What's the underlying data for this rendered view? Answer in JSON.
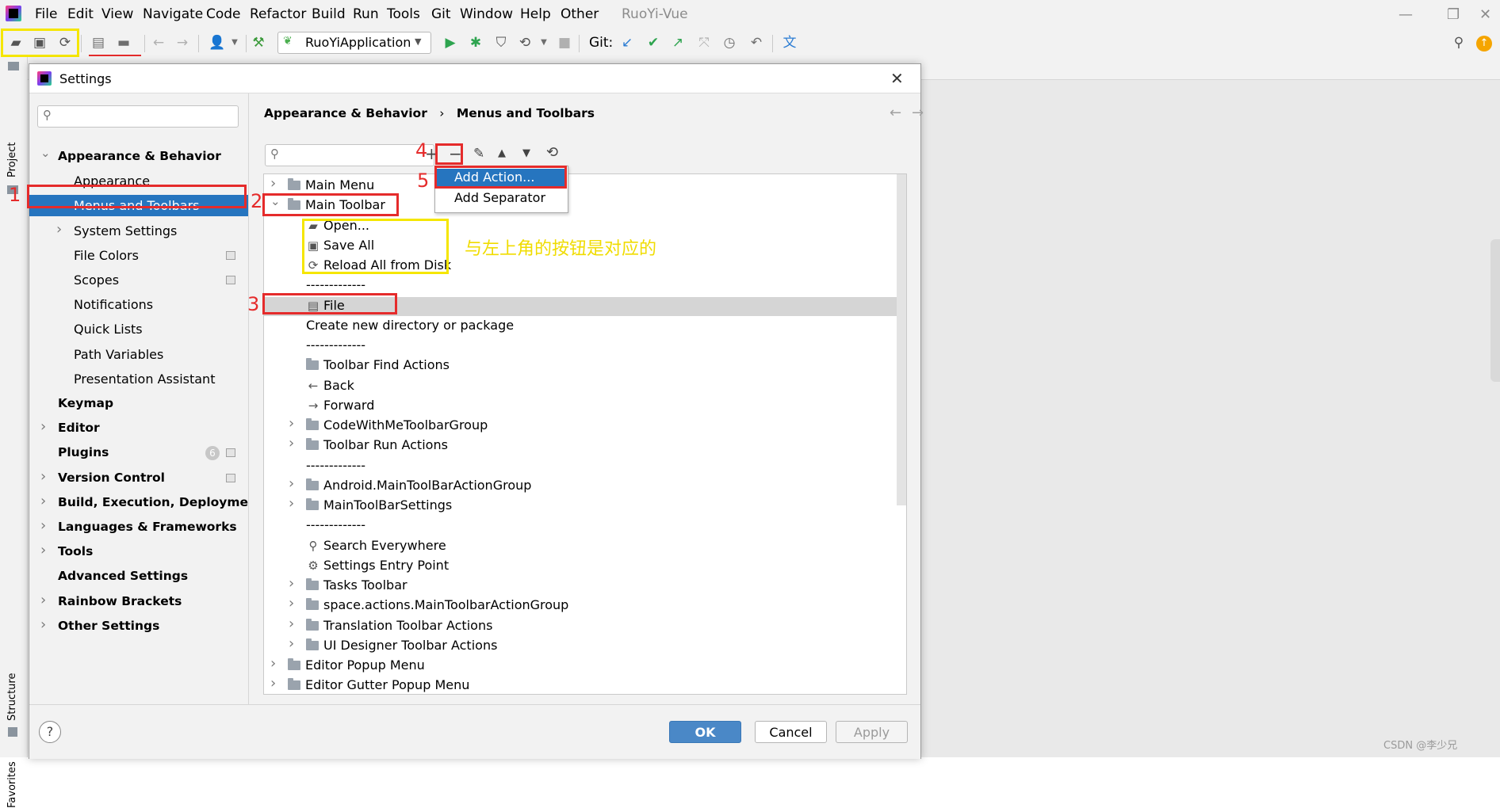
{
  "menubar": {
    "items": [
      "File",
      "Edit",
      "View",
      "Navigate",
      "Code",
      "Refactor",
      "Build",
      "Run",
      "Tools",
      "Git",
      "Window",
      "Help",
      "Other"
    ],
    "project_title": "RuoYi-Vue"
  },
  "toolbar": {
    "run_config": "RuoYiApplication",
    "git_label": "Git:"
  },
  "side_strip": {
    "project": "Project",
    "structure": "Structure",
    "favorites": "Favorites"
  },
  "dialog": {
    "title": "Settings",
    "close_glyph": "✕",
    "breadcrumb": {
      "parent": "Appearance & Behavior",
      "separator": "›",
      "current": "Menus and Toolbars"
    },
    "nav": [
      {
        "label": "Appearance & Behavior",
        "level": 0,
        "bold": true,
        "expanded": true
      },
      {
        "label": "Appearance",
        "level": 1
      },
      {
        "label": "Menus and Toolbars",
        "level": 1,
        "selected": true
      },
      {
        "label": "System Settings",
        "level": 1,
        "collapsible": true
      },
      {
        "label": "File Colors",
        "level": 1,
        "scope_icon": true
      },
      {
        "label": "Scopes",
        "level": 1,
        "scope_icon": true
      },
      {
        "label": "Notifications",
        "level": 1
      },
      {
        "label": "Quick Lists",
        "level": 1
      },
      {
        "label": "Path Variables",
        "level": 1
      },
      {
        "label": "Presentation Assistant",
        "level": 1
      },
      {
        "label": "Keymap",
        "level": 0,
        "bold": true
      },
      {
        "label": "Editor",
        "level": 0,
        "bold": true,
        "collapsible": true
      },
      {
        "label": "Plugins",
        "level": 0,
        "bold": true,
        "badge": "6",
        "scope_icon": true
      },
      {
        "label": "Version Control",
        "level": 0,
        "bold": true,
        "collapsible": true,
        "scope_icon": true
      },
      {
        "label": "Build, Execution, Deployment",
        "level": 0,
        "bold": true,
        "collapsible": true
      },
      {
        "label": "Languages & Frameworks",
        "level": 0,
        "bold": true,
        "collapsible": true
      },
      {
        "label": "Tools",
        "level": 0,
        "bold": true,
        "collapsible": true
      },
      {
        "label": "Advanced Settings",
        "level": 0,
        "bold": true
      },
      {
        "label": "Rainbow Brackets",
        "level": 0,
        "bold": true,
        "collapsible": true
      },
      {
        "label": "Other Settings",
        "level": 0,
        "bold": true,
        "collapsible": true
      }
    ],
    "tree": [
      {
        "label": "Main Menu",
        "indent": 0,
        "icon": "folder-icon",
        "expander": "›"
      },
      {
        "label": "Main Toolbar",
        "indent": 0,
        "icon": "folder-icon",
        "expander": "⌄"
      },
      {
        "label": "Open...",
        "indent": 1,
        "icon": "open-folder-icon"
      },
      {
        "label": "Save All",
        "indent": 1,
        "icon": "save-icon"
      },
      {
        "label": "Reload All from Disk",
        "indent": 1,
        "icon": "reload-icon"
      },
      {
        "label": "-------------",
        "indent": 1,
        "separator": true
      },
      {
        "label": "File",
        "indent": 1,
        "icon": "file-icon",
        "highlighted": true
      },
      {
        "label": "Create new directory or package",
        "indent": 1
      },
      {
        "label": "-------------",
        "indent": 1,
        "separator": true
      },
      {
        "label": "Toolbar Find Actions",
        "indent": 1,
        "icon": "folder-icon"
      },
      {
        "label": "Back",
        "indent": 1,
        "icon": "back-arrow-icon"
      },
      {
        "label": "Forward",
        "indent": 1,
        "icon": "forward-arrow-icon"
      },
      {
        "label": "CodeWithMeToolbarGroup",
        "indent": 1,
        "icon": "folder-icon",
        "expander": "›"
      },
      {
        "label": "Toolbar Run Actions",
        "indent": 1,
        "icon": "folder-icon",
        "expander": "›"
      },
      {
        "label": "-------------",
        "indent": 1,
        "separator": true
      },
      {
        "label": "Android.MainToolBarActionGroup",
        "indent": 1,
        "icon": "folder-icon",
        "expander": "›"
      },
      {
        "label": "MainToolBarSettings",
        "indent": 1,
        "icon": "folder-icon",
        "expander": "›"
      },
      {
        "label": "-------------",
        "indent": 1,
        "separator": true
      },
      {
        "label": "Search Everywhere",
        "indent": 1,
        "icon": "search-icon"
      },
      {
        "label": "Settings Entry Point",
        "indent": 1,
        "icon": "gear-icon"
      },
      {
        "label": "Tasks Toolbar",
        "indent": 1,
        "icon": "folder-icon",
        "expander": "›"
      },
      {
        "label": "space.actions.MainToolbarActionGroup",
        "indent": 1,
        "icon": "folder-icon",
        "expander": "›"
      },
      {
        "label": "Translation Toolbar Actions",
        "indent": 1,
        "icon": "folder-icon",
        "expander": "›"
      },
      {
        "label": "UI Designer Toolbar Actions",
        "indent": 1,
        "icon": "folder-icon",
        "expander": "›"
      },
      {
        "label": "Editor Popup Menu",
        "indent": 0,
        "icon": "folder-icon",
        "expander": "›"
      },
      {
        "label": "Editor Gutter Popup Menu",
        "indent": 0,
        "icon": "folder-icon",
        "expander": "›"
      }
    ],
    "popup": {
      "items": [
        "Add Action...",
        "Add Separator"
      ]
    },
    "buttons": {
      "ok": "OK",
      "cancel": "Cancel",
      "apply": "Apply",
      "help": "?"
    }
  },
  "annotations": {
    "numbers": [
      "1",
      "2",
      "3",
      "4",
      "5"
    ],
    "note": "与左上角的按钮是对应的"
  },
  "watermark": "CSDN @李少兄",
  "colors": {
    "selection": "#2675bf",
    "annotation_red": "#e52b2b",
    "annotation_yellow": "#f5e600"
  }
}
